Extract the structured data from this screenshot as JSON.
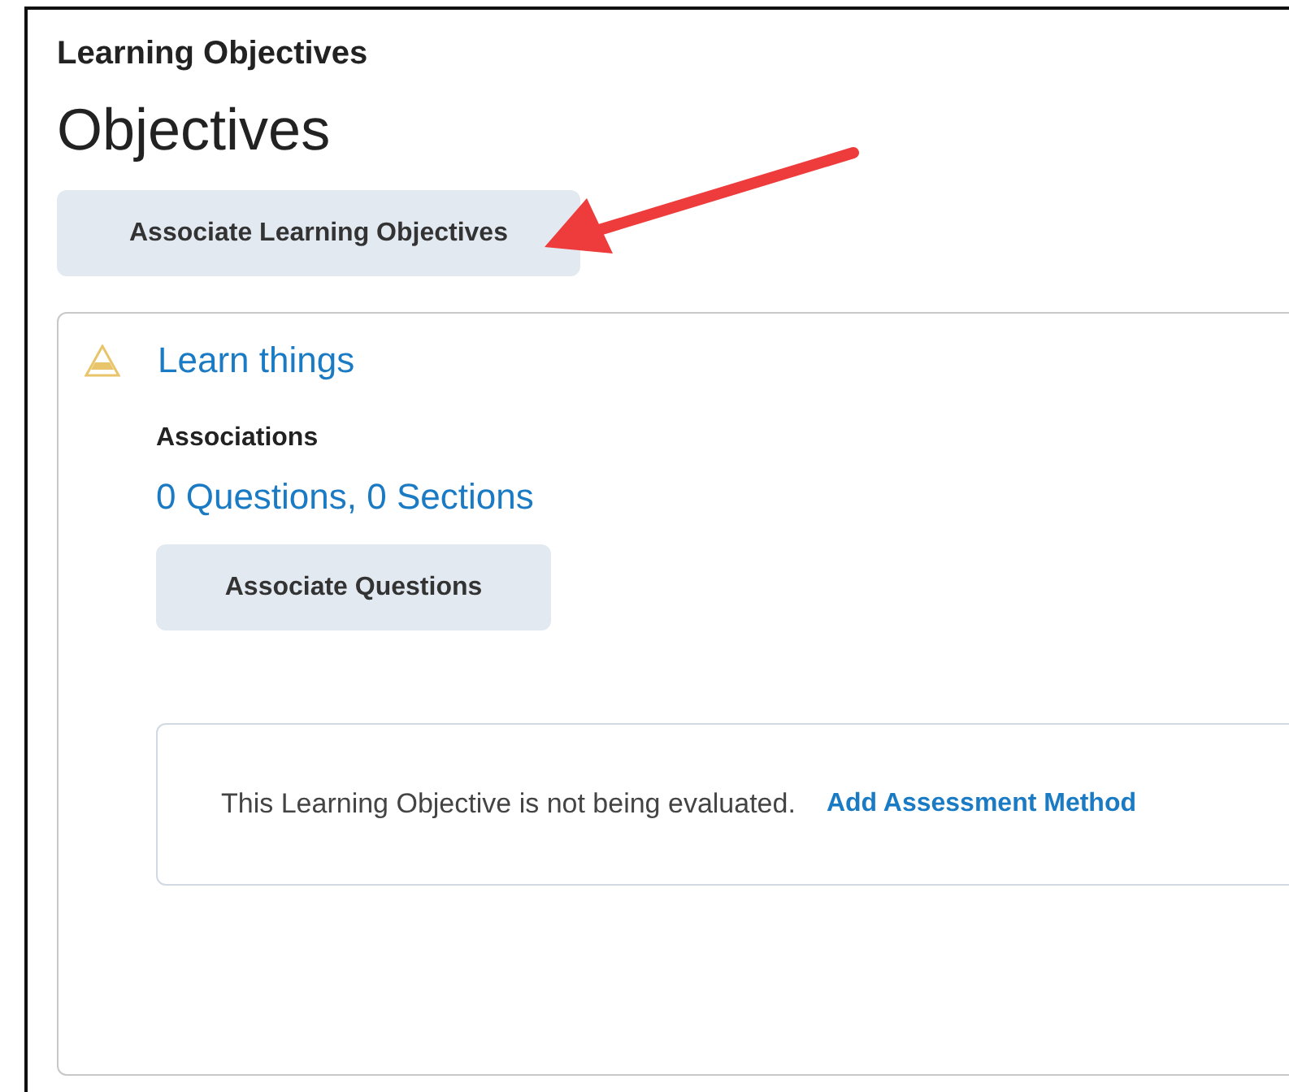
{
  "breadcrumb": "Learning Objectives",
  "heading": "Objectives",
  "primary_button": "Associate Learning Objectives",
  "objective": {
    "title": "Learn things",
    "associations_label": "Associations",
    "associations_link": "0 Questions, 0 Sections",
    "button": "Associate Questions",
    "notice": {
      "message": "This Learning Objective is not being evaluated.",
      "link": "Add Assessment Method"
    }
  }
}
